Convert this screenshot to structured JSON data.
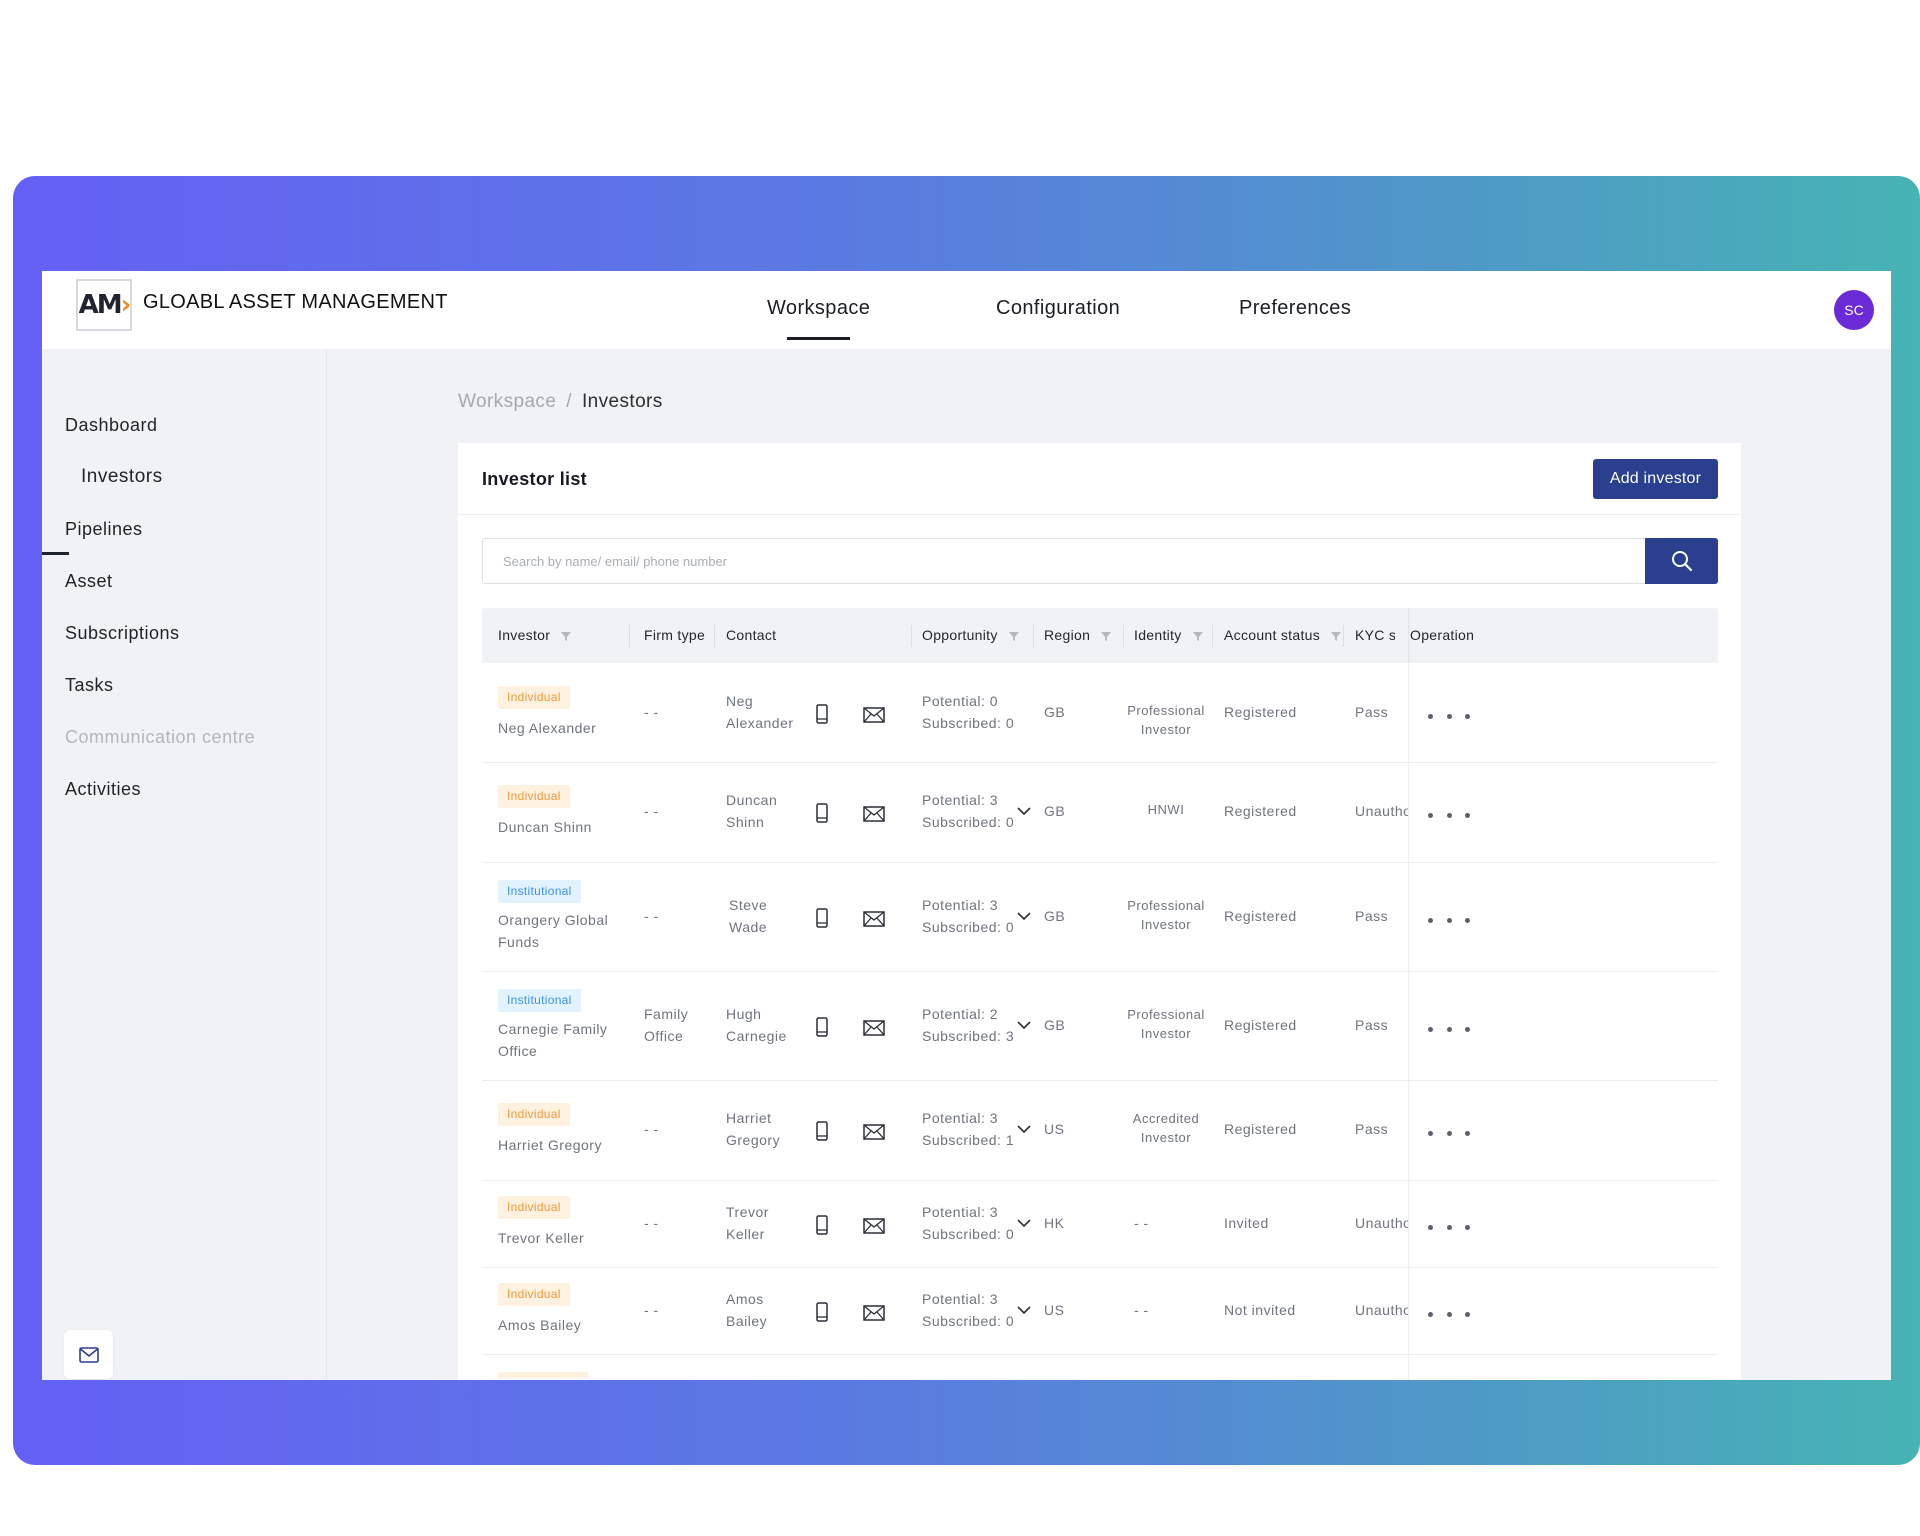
{
  "app": {
    "brand": "GLOABL ASSET MANAGEMENT",
    "logo": {
      "text_main": "AM",
      "text_accent": "›"
    },
    "avatar_initials": "SC"
  },
  "nav": {
    "tabs": [
      {
        "label": "Workspace",
        "active": true
      },
      {
        "label": "Configuration",
        "active": false
      },
      {
        "label": "Preferences",
        "active": false
      }
    ]
  },
  "sidebar": {
    "items": [
      {
        "label": "Dashboard"
      },
      {
        "label": "Investors"
      },
      {
        "label": "Pipelines"
      },
      {
        "label": "Asset"
      },
      {
        "label": "Subscriptions"
      },
      {
        "label": "Tasks"
      },
      {
        "label": "Communication centre"
      },
      {
        "label": "Activities"
      }
    ]
  },
  "breadcrumb": {
    "parent": "Workspace",
    "separator": "/",
    "current": "Investors"
  },
  "card": {
    "title": "Investor list",
    "add_button": "Add investor",
    "search_placeholder": "Search by name/ email/ phone number"
  },
  "table": {
    "headers": {
      "investor": "Investor",
      "firm_type": "Firm type",
      "contact": "Contact",
      "opportunity": "Opportunity",
      "region": "Region",
      "identity": "Identity",
      "account_status": "Account status",
      "kyc_status": "KYC status",
      "operation": "Operation"
    },
    "rows": [
      {
        "tag": "Individual",
        "investor_l1": "Neg Alexander",
        "investor_l2": "",
        "firm_l1": "- -",
        "firm_l2": "",
        "contact_l1": "Neg",
        "contact_l2": "Alexander",
        "potential": "Potential: 0",
        "subscribed": "Subscribed: 0",
        "region": "GB",
        "identity_l1": "Professional",
        "identity_l2": "Investor",
        "account_status": "Registered",
        "kyc": "Pass"
      },
      {
        "tag": "Individual",
        "investor_l1": "Duncan Shinn",
        "investor_l2": "",
        "firm_l1": "- -",
        "firm_l2": "",
        "contact_l1": "Duncan",
        "contact_l2": "Shinn",
        "potential": "Potential: 3",
        "subscribed": "Subscribed: 0",
        "region": "GB",
        "identity_l1": "HNWI",
        "identity_l2": "",
        "account_status": "Registered",
        "kyc": "Unauthorised"
      },
      {
        "tag": "Institutional",
        "investor_l1": "Orangery Global",
        "investor_l2": "Funds",
        "firm_l1": "- -",
        "firm_l2": "",
        "contact_l1": "Steve",
        "contact_l2": "Wade",
        "potential": "Potential: 3",
        "subscribed": "Subscribed: 0",
        "region": "GB",
        "identity_l1": "Professional",
        "identity_l2": "Investor",
        "account_status": "Registered",
        "kyc": "Pass"
      },
      {
        "tag": "Institutional",
        "investor_l1": "Carnegie Family",
        "investor_l2": "Office",
        "firm_l1": "Family",
        "firm_l2": "Office",
        "contact_l1": "Hugh",
        "contact_l2": "Carnegie",
        "potential": "Potential: 2",
        "subscribed": "Subscribed: 3",
        "region": "GB",
        "identity_l1": "Professional",
        "identity_l2": "Investor",
        "account_status": "Registered",
        "kyc": "Pass"
      },
      {
        "tag": "Individual",
        "investor_l1": "Harriet Gregory",
        "investor_l2": "",
        "firm_l1": "- -",
        "firm_l2": "",
        "contact_l1": "Harriet",
        "contact_l2": "Gregory",
        "potential": "Potential: 3",
        "subscribed": "Subscribed: 1",
        "region": "US",
        "identity_l1": "Accredited",
        "identity_l2": "Investor",
        "account_status": "Registered",
        "kyc": "Pass"
      },
      {
        "tag": "Individual",
        "investor_l1": "Trevor Keller",
        "investor_l2": "",
        "firm_l1": "- -",
        "firm_l2": "",
        "contact_l1": "Trevor",
        "contact_l2": "Keller",
        "potential": "Potential: 3",
        "subscribed": "Subscribed: 0",
        "region": "HK",
        "identity_l1": "- -",
        "identity_l2": "",
        "account_status": "Invited",
        "kyc": "Unauthorised"
      },
      {
        "tag": "Individual",
        "investor_l1": "Amos Bailey",
        "investor_l2": "",
        "firm_l1": "- -",
        "firm_l2": "",
        "contact_l1": "Amos",
        "contact_l2": "Bailey",
        "potential": "Potential: 3",
        "subscribed": "Subscribed: 0",
        "region": "US",
        "identity_l1": "- -",
        "identity_l2": "",
        "account_status": "Not invited",
        "kyc": "Unauthorised"
      }
    ]
  },
  "colors": {
    "primary": "#2b3f8f",
    "avatar": "#6a2bd6",
    "tag_individual_bg": "#fff1df",
    "tag_individual_text": "#f09a35",
    "tag_institutional_bg": "#e3f2ff",
    "tag_institutional_text": "#3a94e6"
  }
}
